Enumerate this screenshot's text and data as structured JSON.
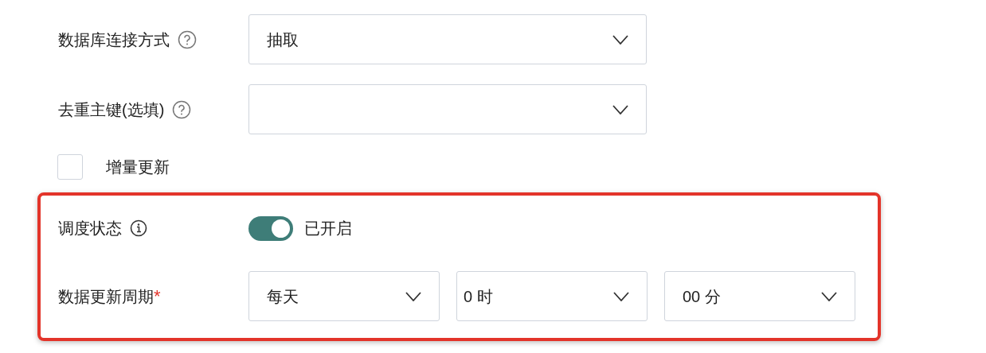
{
  "fields": [
    {
      "kind": "select",
      "label": "数据库连接方式",
      "help": true,
      "value": "抽取"
    },
    {
      "kind": "select",
      "label": "去重主键(选填)",
      "help": true
    },
    {
      "kind": "checkbox",
      "label": "增量更新",
      "checked": false
    }
  ],
  "highlighted": {
    "schedule": {
      "label": "调度状态",
      "on": true,
      "status": "已开启"
    },
    "period": {
      "label": "数据更新周期",
      "required_mark": "*",
      "selects": [
        "每天",
        "0 时",
        "00 分"
      ]
    }
  }
}
